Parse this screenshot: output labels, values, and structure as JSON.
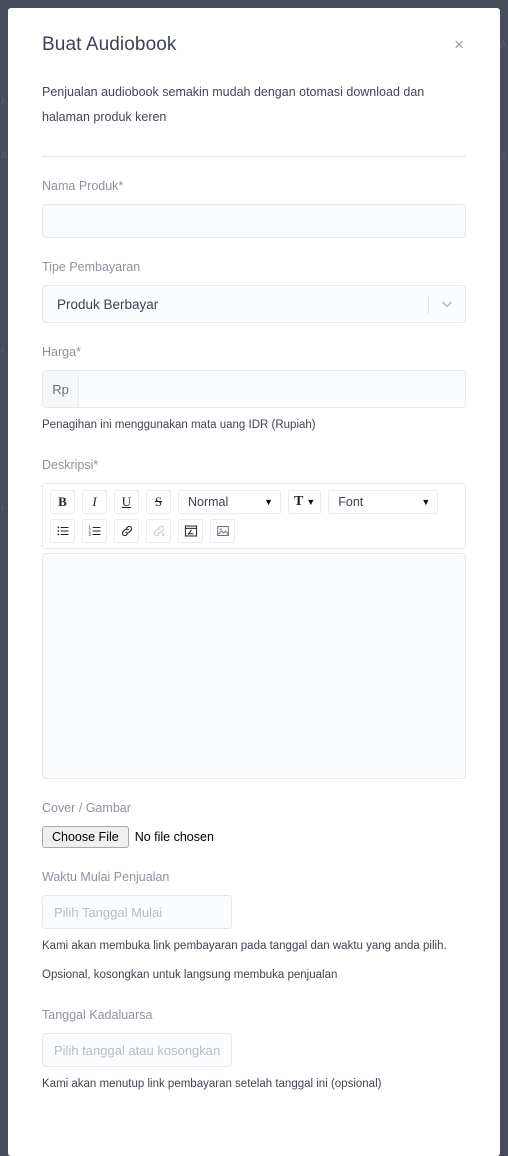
{
  "modal": {
    "title": "Buat Audiobook",
    "close_label": "×",
    "description": "Penjualan audiobook semakin mudah dengan otomasi download dan halaman produk keren"
  },
  "form": {
    "product_name": {
      "label": "Nama Produk*",
      "value": "",
      "placeholder": ""
    },
    "payment_type": {
      "label": "Tipe Pembayaran",
      "selected": "Produk Berbayar"
    },
    "price": {
      "label": "Harga*",
      "currency_prefix": "Rp",
      "value": "",
      "placeholder": "",
      "help": "Penagihan ini menggunakan mata uang IDR (Rupiah)"
    },
    "description": {
      "label": "Deskripsi*",
      "content": ""
    },
    "cover": {
      "label": "Cover / Gambar",
      "button_label": "Choose File",
      "no_file_text": "No file chosen"
    },
    "start_date": {
      "label": "Waktu Mulai Penjualan",
      "value": "",
      "placeholder": "Pilih Tanggal Mulai",
      "help_line_1": "Kami akan membuka link pembayaran pada tanggal dan waktu yang anda pilih.",
      "help_line_2": "Opsional, kosongkan untuk langsung membuka penjualan"
    },
    "expiry_date": {
      "label": "Tanggal Kadaluarsa",
      "value": "",
      "placeholder": "Pilih tanggal atau kosongkan",
      "help": "Kami akan menutup link pembayaran setelah tanggal ini (opsional)"
    }
  },
  "editor_toolbar": {
    "bold": "B",
    "italic": "I",
    "underline": "U",
    "strike": "S",
    "block_format": "Normal",
    "font": "Font",
    "size_glyph": "T",
    "caret": "▼"
  },
  "colors": {
    "backdrop": "#454b58",
    "modal_bg": "#ffffff",
    "title": "#3d4351",
    "label": "#8d939e",
    "input_bg": "#fbfcfd",
    "input_border": "#e4e8ef",
    "help_text": "#3f4551"
  }
}
